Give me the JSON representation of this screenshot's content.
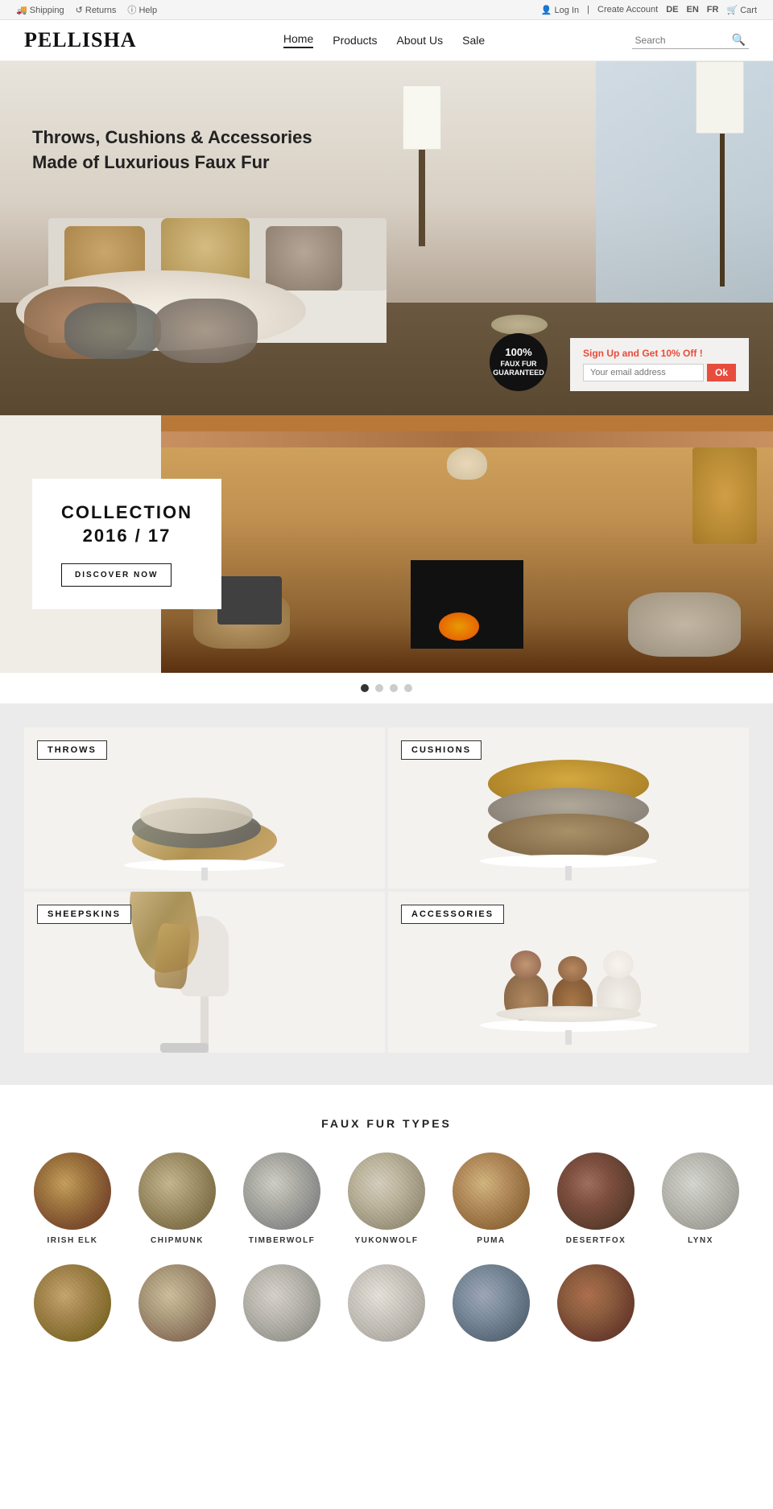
{
  "topbar": {
    "left": {
      "shipping_label": "Shipping",
      "returns_label": "Returns",
      "help_label": "Help"
    },
    "right": {
      "login_label": "Log In",
      "separator": "|",
      "create_account_label": "Create Account",
      "lang_de": "DE",
      "lang_en": "EN",
      "lang_fr": "FR",
      "cart_label": "Cart"
    }
  },
  "header": {
    "logo": "PELLISHA",
    "nav": {
      "home": "Home",
      "products": "Products",
      "about_us": "About Us",
      "sale": "Sale"
    },
    "search_placeholder": "Search"
  },
  "hero": {
    "headline_line1": "Throws, Cushions & Accessories",
    "headline_line2": "Made of Luxurious Faux Fur",
    "signup_text": "Sign Up and Get",
    "discount_text": "10% Off",
    "signup_exclaim": "!",
    "email_placeholder": "Your email address",
    "ok_button": "Ok",
    "guarantee_line1": "100%",
    "guarantee_line2": "FAUX FUR",
    "guarantee_line3": "GUARANTEED"
  },
  "collection": {
    "title_line1": "COLLECTION",
    "title_line2": "2016 / 17",
    "discover_btn": "DISCOVER NOW"
  },
  "carousel": {
    "dots": [
      1,
      2,
      3,
      4
    ],
    "active_dot": 0
  },
  "categories": {
    "title": "",
    "items": [
      {
        "label": "THROWS",
        "id": "throws"
      },
      {
        "label": "CUSHIONS",
        "id": "cushions"
      },
      {
        "label": "SHEEPSKINS",
        "id": "sheepskins"
      },
      {
        "label": "ACCESSORIES",
        "id": "accessories"
      }
    ]
  },
  "fur_types": {
    "title": "FAUX FUR TYPES",
    "row1": [
      {
        "name": "IRISH ELK",
        "css_class": "fur-irish-elk"
      },
      {
        "name": "CHIPMUNK",
        "css_class": "fur-chipmunk"
      },
      {
        "name": "TIMBERWOLF",
        "css_class": "fur-timberwolf"
      },
      {
        "name": "YUKONWOLF",
        "css_class": "fur-yukonwolf"
      },
      {
        "name": "PUMA",
        "css_class": "fur-puma"
      },
      {
        "name": "DESERTFOX",
        "css_class": "fur-desertfox"
      },
      {
        "name": "LYNX",
        "css_class": "fur-lynx"
      }
    ],
    "row2": [
      {
        "name": "",
        "css_class": "fur-row2-1"
      },
      {
        "name": "",
        "css_class": "fur-row2-2"
      },
      {
        "name": "",
        "css_class": "fur-row2-3"
      },
      {
        "name": "",
        "css_class": "fur-row2-4"
      },
      {
        "name": "",
        "css_class": "fur-row2-5"
      },
      {
        "name": "",
        "css_class": "fur-row2-6"
      }
    ]
  }
}
